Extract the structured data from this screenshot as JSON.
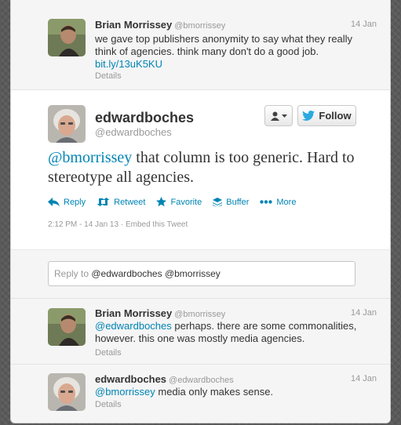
{
  "tweet_prev": {
    "name": "Brian Morrissey",
    "handle": "@bmorrissey",
    "date": "14 Jan",
    "text": "we gave top publishers anonymity to say what they really think of agencies. think many don't do a good job.",
    "link": "bit.ly/13uK5KU",
    "details": "Details"
  },
  "focused": {
    "name": "edwardboches",
    "handle": "@edwardboches",
    "follow_label": "Follow",
    "mention": "@bmorrissey",
    "text": " that column is too generic. Hard to stereotype all agencies.",
    "actions": {
      "reply": "Reply",
      "retweet": "Retweet",
      "favorite": "Favorite",
      "buffer": "Buffer",
      "more": "More"
    },
    "timestamp": "2:12 PM - 14 Jan 13",
    "embed": "Embed this Tweet"
  },
  "reply_box": {
    "prefix": "Reply to",
    "mentions": "@edwardboches @bmorrissey"
  },
  "replies": [
    {
      "name": "Brian Morrissey",
      "handle": "@bmorrissey",
      "date": "14 Jan",
      "mention": "@edwardboches",
      "text": " perhaps. there are some commonalities, however. this one was mostly media agencies.",
      "details": "Details"
    },
    {
      "name": "edwardboches",
      "handle": "@edwardboches",
      "date": "14 Jan",
      "mention": "@bmorrissey",
      "text": " media only makes sense.",
      "details": "Details"
    }
  ],
  "colors": {
    "link": "#0084b4",
    "twitter_bird": "#2aa9e0",
    "muted": "#999999"
  },
  "icons": [
    "avatar-brian",
    "avatar-edward",
    "user-icon",
    "caret-down-icon",
    "twitter-bird-icon",
    "reply-icon",
    "retweet-icon",
    "star-icon",
    "buffer-icon",
    "more-dots-icon"
  ]
}
